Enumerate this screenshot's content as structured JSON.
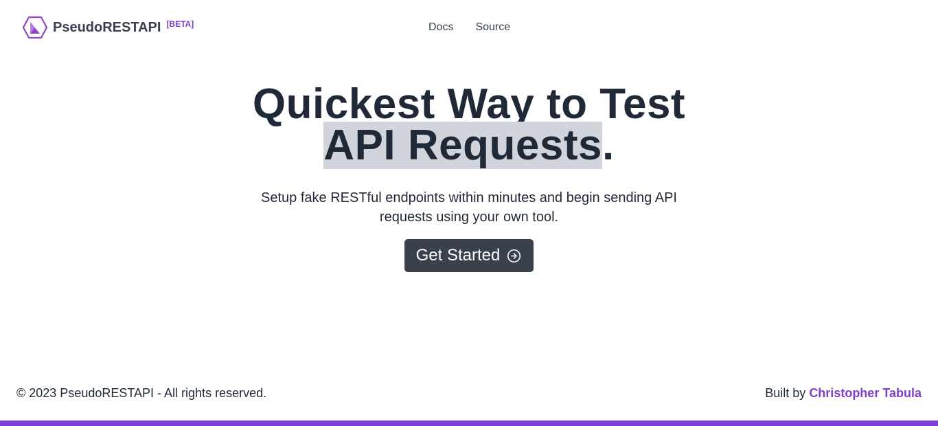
{
  "header": {
    "brand_name": "PseudoRESTAPI",
    "badge": "[BETA]",
    "logo_icon": "hexagon-logo-icon",
    "nav": [
      {
        "label": "Docs"
      },
      {
        "label": "Source"
      }
    ]
  },
  "hero": {
    "title_line1": "Quickest Way to Test",
    "title_highlight": "API Requests",
    "title_suffix": ".",
    "subtitle": "Setup fake RESTful endpoints within minutes and begin sending API requests using your own tool.",
    "cta_label": "Get Started",
    "cta_icon": "arrow-right-circle-icon"
  },
  "footer": {
    "copyright": "© 2023 PseudoRESTAPI - All rights reserved.",
    "built_by_prefix": "Built by",
    "author": "Christopher Tabula"
  },
  "colors": {
    "accent": "#7e3fd6",
    "text": "#1f2937",
    "button_bg": "#3a404c",
    "highlight_bg": "#d1d5db"
  }
}
